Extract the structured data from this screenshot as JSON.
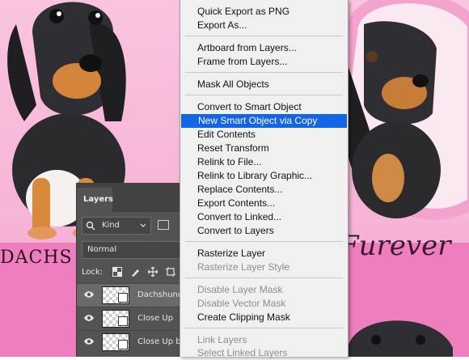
{
  "canvas": {
    "left_text": "DACHS",
    "right_text": "Furever"
  },
  "layers_panel": {
    "tab": "Layers",
    "filter_kind": "Kind",
    "blend_mode": "Normal",
    "lock_label": "Lock:",
    "layers": [
      {
        "name": "Dachshund",
        "selected": true
      },
      {
        "name": "Close Up",
        "selected": false
      },
      {
        "name": "Close Up bc",
        "selected": false
      }
    ]
  },
  "context_menu": {
    "items": [
      {
        "label": "Quick Export as PNG",
        "enabled": true
      },
      {
        "label": "Export As...",
        "enabled": true
      },
      {
        "separator": true
      },
      {
        "label": "Artboard from Layers...",
        "enabled": true
      },
      {
        "label": "Frame from Layers...",
        "enabled": true
      },
      {
        "separator": true
      },
      {
        "label": "Mask All Objects",
        "enabled": true
      },
      {
        "separator": true
      },
      {
        "label": "Convert to Smart Object",
        "enabled": true
      },
      {
        "label": "New Smart Object via Copy",
        "enabled": true,
        "highlighted": true
      },
      {
        "label": "Edit Contents",
        "enabled": true
      },
      {
        "label": "Reset Transform",
        "enabled": true
      },
      {
        "label": "Relink to File...",
        "enabled": true
      },
      {
        "label": "Relink to Library Graphic...",
        "enabled": true
      },
      {
        "label": "Replace Contents...",
        "enabled": true
      },
      {
        "label": "Export Contents...",
        "enabled": true
      },
      {
        "label": "Convert to Linked...",
        "enabled": true
      },
      {
        "label": "Convert to Layers",
        "enabled": true
      },
      {
        "separator": true
      },
      {
        "label": "Rasterize Layer",
        "enabled": true
      },
      {
        "label": "Rasterize Layer Style",
        "enabled": false
      },
      {
        "separator": true
      },
      {
        "label": "Disable Layer Mask",
        "enabled": false
      },
      {
        "label": "Disable Vector Mask",
        "enabled": false
      },
      {
        "label": "Create Clipping Mask",
        "enabled": true
      },
      {
        "separator": true
      },
      {
        "label": "Link Layers",
        "enabled": false
      },
      {
        "label": "Select Linked Layers",
        "enabled": false
      }
    ]
  },
  "colors": {
    "menu_highlight": "#1464e6",
    "panel_bg": "#535353",
    "canvas_pink": "#f6b2d6",
    "canvas_band": "#ef7ebf"
  }
}
